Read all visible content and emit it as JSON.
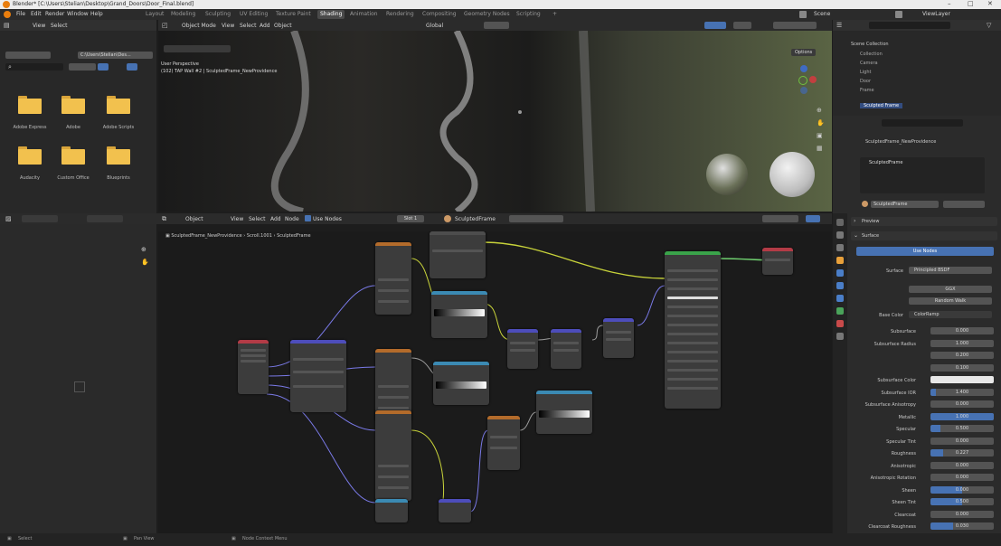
{
  "window": {
    "title": "Blender* [C:\\Users\\Stelian\\Desktop\\Grand_Doors\\Door_Final.blend]",
    "controls": [
      "–",
      "□",
      "✕"
    ]
  },
  "menu": [
    "File",
    "Edit",
    "Render",
    "Window",
    "Help"
  ],
  "workspaces": [
    "Layout",
    "Modeling",
    "Sculpting",
    "UV Editing",
    "Texture Paint",
    "Shading",
    "Animation",
    "Rendering",
    "Compositing",
    "Geometry Nodes",
    "Scripting",
    "+"
  ],
  "active_workspace": "Shading",
  "scene": {
    "label": "Scene",
    "view_layer": "ViewLayer"
  },
  "filebrowser": {
    "header": [
      "View",
      "Select"
    ],
    "path": "C:\\Users\\Stelian\\Des...",
    "folders": [
      "Adobe Express",
      "Adobe",
      "Adobe Scripts",
      "Audacity",
      "Custom Office",
      "Blueprints"
    ]
  },
  "viewport": {
    "header": [
      "Object Mode",
      "View",
      "Select",
      "Add",
      "Object"
    ],
    "transform": "Global",
    "options": "Options",
    "camera_label": "User Perspective",
    "camera_sub": "(102) TAP Wall #2 | SculptedFrame_NewProvidence"
  },
  "node_editor": {
    "header": [
      "Object",
      "View",
      "Select",
      "Add",
      "Node",
      "Use Nodes"
    ],
    "slot": "Slot 1",
    "material": "SculptedFrame",
    "breadcrumbs": [
      "SculptedFrame_NewProvidence",
      "Scroll.1001",
      "SculptedFrame"
    ]
  },
  "outliner": {
    "search_placeholder": "",
    "items": [
      "Scene Collection",
      "Collection",
      "Camera",
      "Light",
      "Door",
      "Frame",
      "Sculpted Frame"
    ]
  },
  "material_panel": {
    "material_list": [
      "SculptedFrame"
    ],
    "material_field": "SculptedFrame",
    "sections": [
      "Preview",
      "Surface"
    ],
    "use_nodes": "Use Nodes",
    "surface_label": "Surface",
    "surface_value": "Principled BSDF",
    "dist_value": "GGX",
    "sss_value": "Random Walk",
    "base_color_label": "Base Color",
    "base_color_value": "ColorRamp",
    "rows": [
      {
        "label": "Subsurface",
        "value": "0.000",
        "fill": 0
      },
      {
        "label": "Subsurface Radius",
        "value": "1.000",
        "fill": 0
      },
      {
        "label": "",
        "value": "0.200",
        "fill": 0
      },
      {
        "label": "",
        "value": "0.100",
        "fill": 0
      },
      {
        "label": "Subsurface Color",
        "value": "",
        "fill": 0
      },
      {
        "label": "Subsurface IOR",
        "value": "1.400",
        "fill": 0.08
      },
      {
        "label": "Subsurface Anisotropy",
        "value": "0.000",
        "fill": 0
      },
      {
        "label": "Metallic",
        "value": "1.000",
        "fill": 1
      },
      {
        "label": "Specular",
        "value": "0.500",
        "fill": 0.15
      },
      {
        "label": "Specular Tint",
        "value": "0.000",
        "fill": 0
      },
      {
        "label": "Roughness",
        "value": "0.227",
        "fill": 0.2
      },
      {
        "label": "Anisotropic",
        "value": "0.000",
        "fill": 0
      },
      {
        "label": "Anisotropic Rotation",
        "value": "0.000",
        "fill": 0
      },
      {
        "label": "Sheen",
        "value": "0.000",
        "fill": 0.5
      },
      {
        "label": "Sheen Tint",
        "value": "0.500",
        "fill": 0.5
      },
      {
        "label": "Clearcoat",
        "value": "0.000",
        "fill": 0
      },
      {
        "label": "Clearcoat Roughness",
        "value": "0.030",
        "fill": 0.35
      }
    ]
  },
  "statusbar": [
    "Select",
    "Pan View",
    "Node Context Menu"
  ],
  "colors": {
    "accent": "#4772b3",
    "folder": "#f2c14e",
    "bg": "#1d1d1d"
  }
}
